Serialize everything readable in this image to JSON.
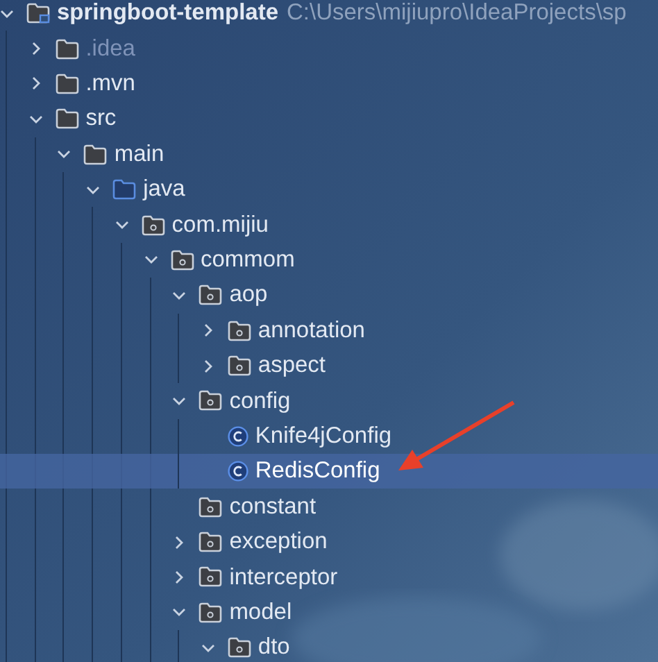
{
  "tree": [
    {
      "label": "springboot-template",
      "path": "C:\\Users\\mijiupro\\IdeaProjects\\sp",
      "kind": "project",
      "expanded": true,
      "selected": false,
      "children": [
        {
          "label": ".idea",
          "kind": "ignored-folder",
          "expanded": false,
          "selected": false
        },
        {
          "label": ".mvn",
          "kind": "folder",
          "expanded": false,
          "selected": false
        },
        {
          "label": "src",
          "kind": "folder",
          "expanded": true,
          "selected": false,
          "children": [
            {
              "label": "main",
              "kind": "folder",
              "expanded": true,
              "selected": false,
              "children": [
                {
                  "label": "java",
                  "kind": "source-folder",
                  "expanded": true,
                  "selected": false,
                  "children": [
                    {
                      "label": "com.mijiu",
                      "kind": "package",
                      "expanded": true,
                      "selected": false,
                      "children": [
                        {
                          "label": "commom",
                          "kind": "package",
                          "expanded": true,
                          "selected": false,
                          "children": [
                            {
                              "label": "aop",
                              "kind": "package",
                              "expanded": true,
                              "selected": false,
                              "children": [
                                {
                                  "label": "annotation",
                                  "kind": "package",
                                  "expanded": false,
                                  "selected": false
                                },
                                {
                                  "label": "aspect",
                                  "kind": "package",
                                  "expanded": false,
                                  "selected": false
                                }
                              ]
                            },
                            {
                              "label": "config",
                              "kind": "package",
                              "expanded": true,
                              "selected": false,
                              "children": [
                                {
                                  "label": "Knife4jConfig",
                                  "kind": "class",
                                  "selected": false
                                },
                                {
                                  "label": "RedisConfig",
                                  "kind": "class",
                                  "selected": true
                                }
                              ]
                            },
                            {
                              "label": "constant",
                              "kind": "package",
                              "selected": false
                            },
                            {
                              "label": "exception",
                              "kind": "package",
                              "expanded": false,
                              "selected": false
                            },
                            {
                              "label": "interceptor",
                              "kind": "package",
                              "expanded": false,
                              "selected": false
                            },
                            {
                              "label": "model",
                              "kind": "package",
                              "expanded": true,
                              "selected": false,
                              "children": [
                                {
                                  "label": "dto",
                                  "kind": "package",
                                  "expanded": true,
                                  "selected": false
                                }
                              ]
                            }
                          ]
                        }
                      ]
                    }
                  ]
                }
              ]
            }
          ]
        }
      ]
    }
  ]
}
